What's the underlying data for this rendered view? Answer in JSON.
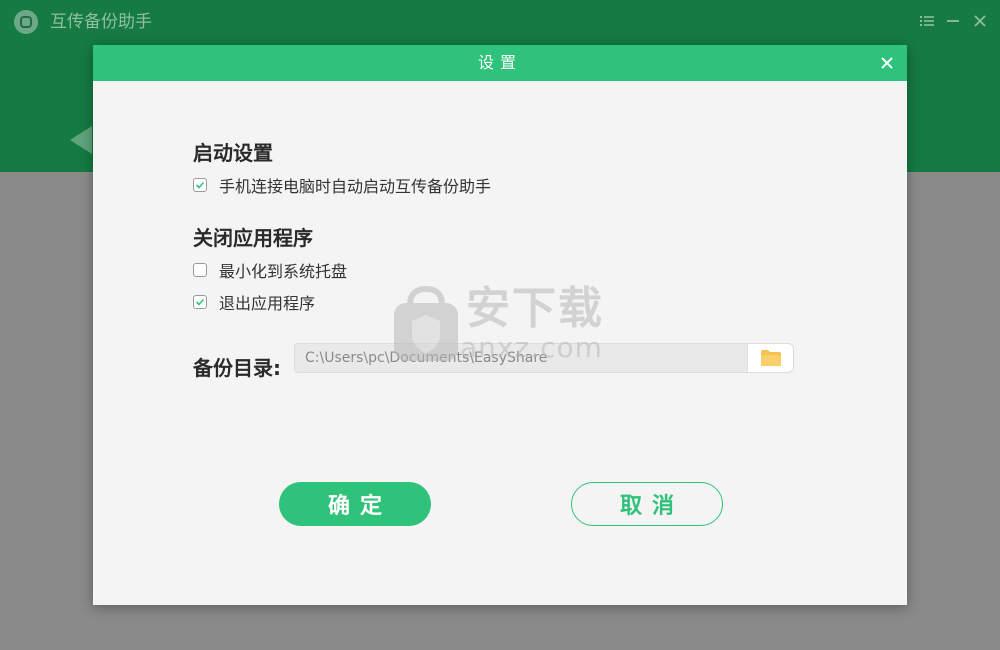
{
  "app": {
    "title": "互传备份助手"
  },
  "dialog": {
    "title": "设置",
    "startup_heading": "启动设置",
    "startup_option": {
      "label": "手机连接电脑时自动启动互传备份助手",
      "checked": true
    },
    "close_heading": "关闭应用程序",
    "close_options": [
      {
        "label": "最小化到系统托盘",
        "checked": false
      },
      {
        "label": "退出应用程序",
        "checked": true
      }
    ],
    "backup_dir_label": "备份目录:",
    "backup_dir_value": "C:\\Users\\pc\\Documents\\EasyShare",
    "ok_label": "确定",
    "cancel_label": "取消"
  },
  "watermark": {
    "text": "安下载",
    "sub": "anxz.com"
  },
  "colors": {
    "header_green": "#157b43",
    "accent_green": "#2fc27a",
    "folder_yellow": "#f7c052"
  },
  "icons": {
    "app_logo": "app-logo-icon",
    "menu": "menu-icon",
    "minimize": "minimize-icon",
    "close": "close-icon",
    "dialog_close": "close-icon",
    "checkbox_checked": "checkmark-icon",
    "folder": "folder-icon"
  }
}
